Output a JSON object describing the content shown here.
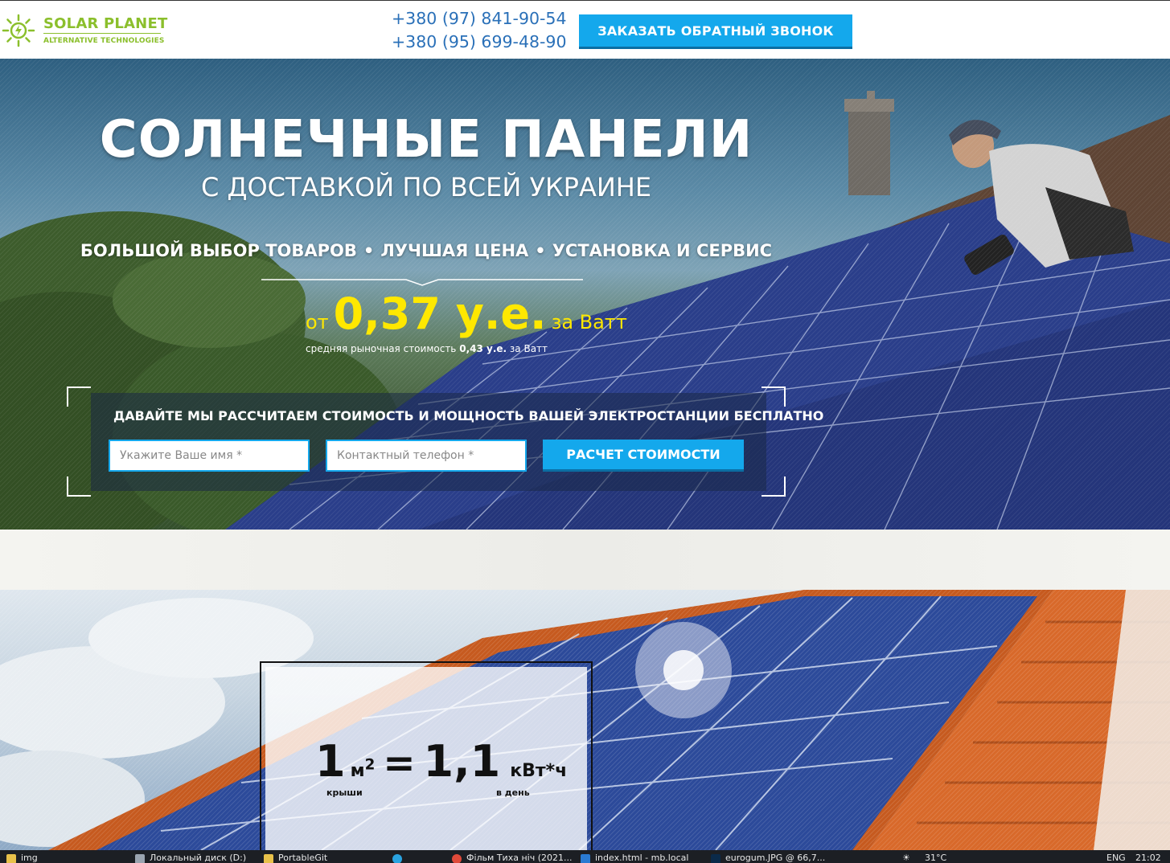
{
  "header": {
    "logo_title": "SOLAR PLANET",
    "logo_subtitle": "ALTERNATIVE TECHNOLOGIES",
    "phones": [
      "+380 (97) 841-90-54",
      "+380 (95) 699-48-90"
    ],
    "callback_label": "ЗАКАЗАТЬ ОБРАТНЫЙ ЗВОНОК"
  },
  "hero": {
    "title": "СОЛНЕЧНЫЕ ПАНЕЛИ",
    "subtitle": "С ДОСТАВКОЙ ПО ВСЕЙ УКРАИНЕ",
    "features": [
      "БОЛЬШОЙ ВЫБОР ТОВАРОВ",
      "ЛУЧШАЯ ЦЕНА",
      "УСТАНОВКА И СЕРВИС"
    ],
    "feature_separator": "•",
    "price": {
      "prefix": "от",
      "value": "0,37 у.е.",
      "suffix": "за Ватт",
      "note_prefix": "средняя рыночная стоимость",
      "note_value": "0,43 у.е.",
      "note_suffix": "за Ватт"
    },
    "form": {
      "title": "ДАВАЙТЕ МЫ РАССЧИТАЕМ СТОИМОСТЬ И МОЩНОСТЬ ВАШЕЙ ЭЛЕКТРОСТАНЦИИ БЕСПЛАТНО",
      "name_placeholder": "Укажите Ваше имя *",
      "phone_placeholder": "Контактный телефон *",
      "submit_label": "РАСЧЕТ СТОИМОСТИ"
    }
  },
  "stat": {
    "left_number": "1",
    "left_unit": "м",
    "left_unit_sup": "2",
    "equals": "=",
    "right_number": "1,1",
    "right_unit": "кВт*ч",
    "left_caption": "крыши",
    "right_caption": "в день"
  },
  "taskbar": {
    "items": [
      "img",
      "Локальный диск (D:)",
      "PortableGit",
      "",
      "Фільм Тиха ніч (2021...",
      "index.html - mb.local",
      "eurogum.JPG @ 66,7..."
    ],
    "weather": "31°C",
    "language": "ENG",
    "time": "21:02"
  },
  "colors": {
    "brand_green": "#8bbf2c",
    "phone_blue": "#2a70b8",
    "button_blue": "#14a8ec",
    "price_yellow": "#ffe800"
  }
}
